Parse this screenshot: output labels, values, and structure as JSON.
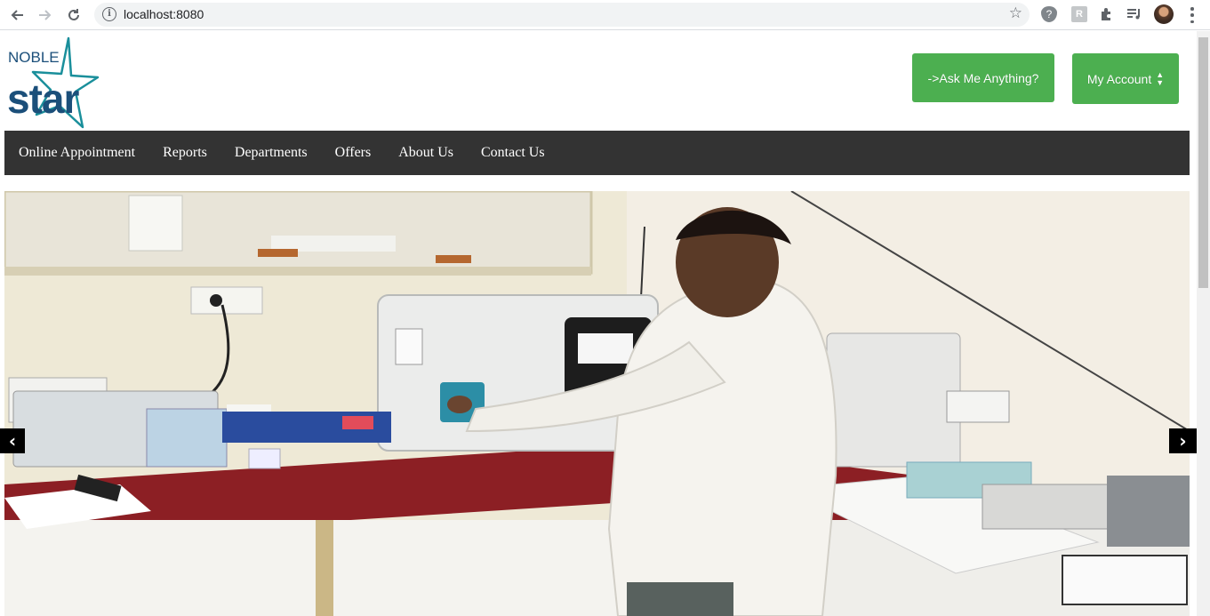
{
  "browser": {
    "url": "localhost:8080"
  },
  "header": {
    "logo_top": "NOBLE",
    "logo_bottom": "star",
    "ask_button": "->Ask Me Anything?",
    "account_button": "My Account"
  },
  "navbar": {
    "items": [
      "Online Appointment",
      "Reports",
      "Departments",
      "Offers",
      "About Us",
      "Contact Us"
    ]
  },
  "slideshow": {
    "prev_label": "‹",
    "next_label": "›",
    "image_subject": "lab technician operating blood analyzer"
  },
  "colors": {
    "accent_green": "#4caf50",
    "navbar_bg": "#333333",
    "logo_blue": "#1b4f7a",
    "logo_teal": "#1a8f9b"
  }
}
